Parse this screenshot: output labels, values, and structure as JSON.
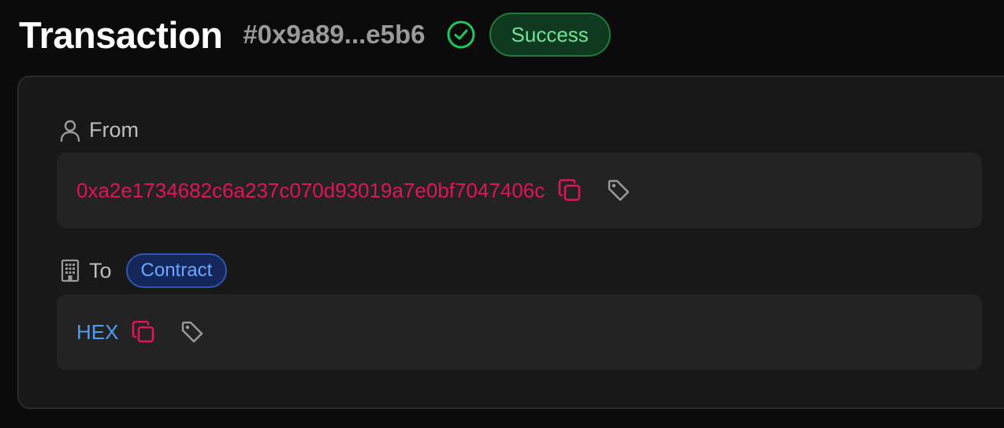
{
  "header": {
    "title": "Transaction",
    "hash": "#0x9a89...e5b6",
    "status": "Success",
    "status_icon": "check-circle-icon",
    "colors": {
      "success_green": "#22c55e",
      "success_badge_bg": "#0f3a1f",
      "success_badge_text": "#6fe39a"
    }
  },
  "from": {
    "label": "From",
    "icon": "user-icon",
    "address": "0xa2e1734682c6a237c070d93019a7e0bf7047406c",
    "actions": [
      "copy-icon",
      "tag-icon"
    ],
    "address_color": "#e0135d"
  },
  "to": {
    "label": "To",
    "icon": "building-icon",
    "badge": "Contract",
    "name": "HEX",
    "actions": [
      "copy-icon",
      "tag-icon"
    ],
    "name_color": "#4f9cf5"
  }
}
